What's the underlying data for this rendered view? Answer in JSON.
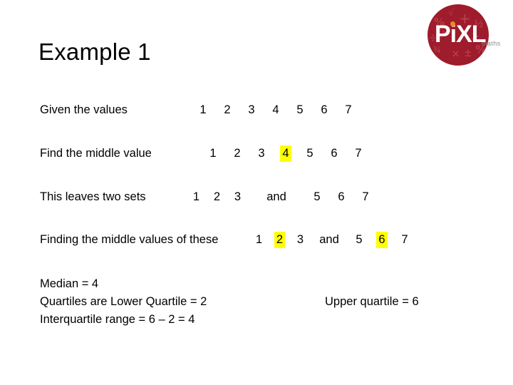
{
  "slide": {
    "title": "Example 1",
    "background_color": "#ffffff",
    "text_color": "#000000",
    "highlight_color": "#ffff00"
  },
  "logo": {
    "name": "PiXL maths",
    "wordmark": "PiXL",
    "subtitle": "maths",
    "circle_color": "#9e1c2b",
    "symbol_color": "#b8404f",
    "dot_color": "#f08a1e",
    "subtitle_color": "#8c8c8c",
    "symbols": [
      "%",
      "√",
      "+",
      "½",
      "÷",
      "¾",
      "×",
      "±",
      "%",
      "=",
      ">"
    ]
  },
  "lines": {
    "line1": {
      "label": "Given the values",
      "numbers": [
        "1",
        "2",
        "3",
        "4",
        "5",
        "6",
        "7"
      ],
      "highlighted": []
    },
    "line2": {
      "label": "Find the middle value",
      "numbers": [
        "1",
        "2",
        "3",
        "4",
        "5",
        "6",
        "7"
      ],
      "highlighted": [
        "4"
      ]
    },
    "line3": {
      "label": "This leaves two sets",
      "left_set": [
        "1",
        "2",
        "3"
      ],
      "conjunction": "and",
      "right_set": [
        "5",
        "6",
        "7"
      ],
      "highlighted": []
    },
    "line4": {
      "label": "Finding the middle values of these",
      "left_set": [
        "1",
        "2",
        "3"
      ],
      "conjunction": "and",
      "right_set": [
        "5",
        "6",
        "7"
      ],
      "highlighted": [
        "2",
        "6"
      ]
    }
  },
  "results": {
    "median": "Median = 4",
    "quartiles_label": "Quartiles are   Lower Quartile = 2",
    "upper_quartile": "Upper quartile = 6",
    "interquartile_range": "Interquartile range  =  6 – 2 =  4"
  }
}
